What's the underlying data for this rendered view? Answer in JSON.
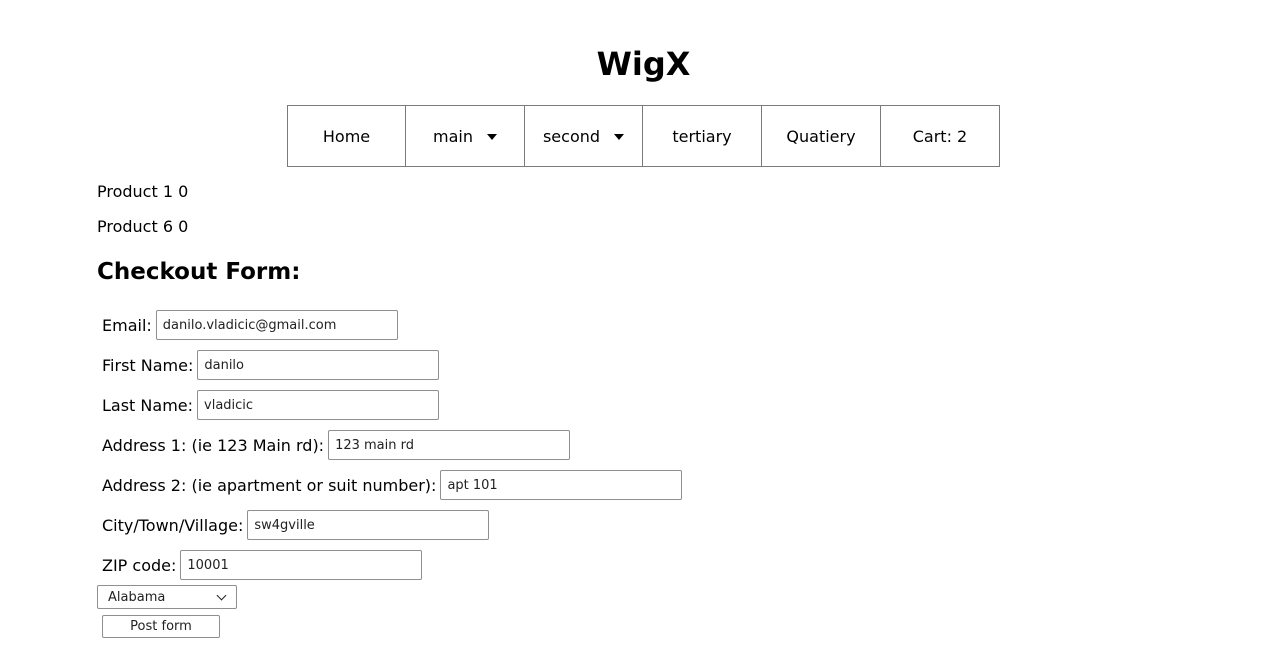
{
  "site": {
    "title": "WigX"
  },
  "nav": {
    "items": [
      {
        "label": "Home",
        "has_dropdown": false
      },
      {
        "label": "main",
        "has_dropdown": true
      },
      {
        "label": "second",
        "has_dropdown": true
      },
      {
        "label": "tertiary",
        "has_dropdown": false
      },
      {
        "label": "Quatiery",
        "has_dropdown": false
      },
      {
        "label": "Cart: 2",
        "has_dropdown": false
      }
    ]
  },
  "products": [
    {
      "text": "Product 1 0"
    },
    {
      "text": "Product 6 0"
    }
  ],
  "form": {
    "heading": "Checkout Form:",
    "fields": {
      "email": {
        "label": "Email:",
        "value": "danilo.vladicic@gmail.com"
      },
      "first_name": {
        "label": "First Name:",
        "value": "danilo"
      },
      "last_name": {
        "label": "Last Name:",
        "value": "vladicic"
      },
      "address1": {
        "label": "Address 1: (ie 123 Main rd):",
        "value": "123 main rd"
      },
      "address2": {
        "label": "Address 2: (ie apartment or suit number):",
        "value": "apt 101"
      },
      "city": {
        "label": "City/Town/Village:",
        "value": "sw4gville"
      },
      "zip": {
        "label": "ZIP code:",
        "value": "10001"
      }
    },
    "state_select": {
      "selected": "Alabama"
    },
    "submit_label": "Post form"
  },
  "icons": {
    "nav_dropdown": "caret-down-icon",
    "select_dropdown": "chevron-down-icon"
  }
}
